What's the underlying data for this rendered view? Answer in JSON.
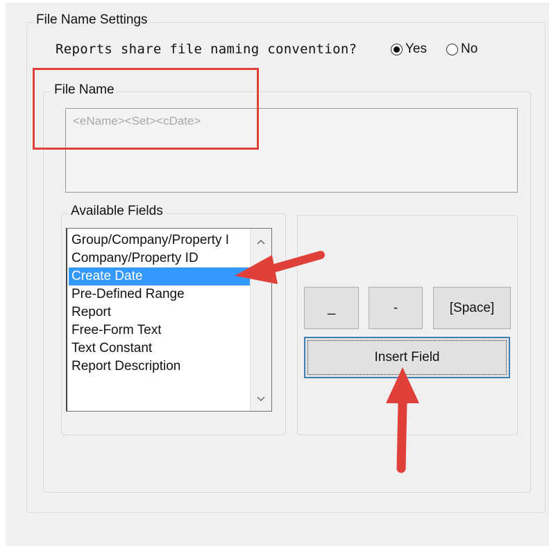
{
  "file_name_settings": {
    "legend": "File Name Settings",
    "question": "Reports share file naming convention?",
    "radio_yes": {
      "label": "Yes",
      "selected": true
    },
    "radio_no": {
      "label": "No",
      "selected": false
    }
  },
  "file_name": {
    "legend": "File Name",
    "value": "<eName><Set><cDate>"
  },
  "available_fields": {
    "legend": "Available Fields",
    "items": [
      {
        "label": "Group/Company/Property I",
        "selected": false
      },
      {
        "label": "Company/Property ID",
        "selected": false
      },
      {
        "label": "Create Date",
        "selected": true
      },
      {
        "label": "Pre-Defined Range",
        "selected": false
      },
      {
        "label": "Report",
        "selected": false
      },
      {
        "label": "Free-Form Text",
        "selected": false
      },
      {
        "label": "Text Constant",
        "selected": false
      },
      {
        "label": "Report Description",
        "selected": false
      }
    ],
    "scroll_up_icon": "chevron-up-icon",
    "scroll_down_icon": "chevron-down-icon"
  },
  "buttons": {
    "underscore_label": "_",
    "dash_label": "-",
    "space_label": "[Space]",
    "insert_field_label": "Insert Field"
  },
  "annotations": {
    "color": "#e0403a"
  }
}
